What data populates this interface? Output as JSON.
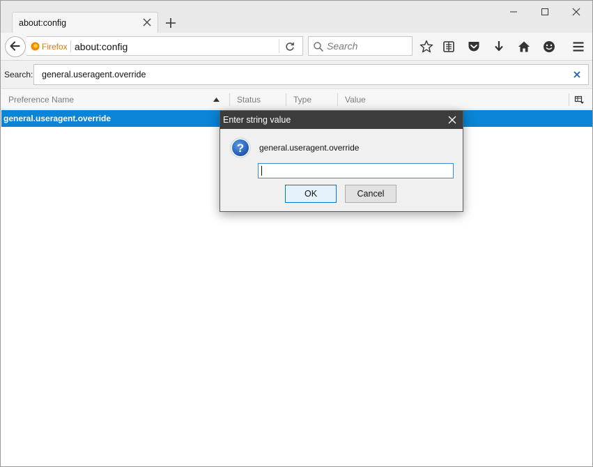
{
  "tab": {
    "title": "about:config"
  },
  "navbar": {
    "identity_label": "Firefox",
    "url": "about:config",
    "search_placeholder": "Search"
  },
  "config_search": {
    "label": "Search:",
    "value": "general.useragent.override"
  },
  "columns": {
    "name": "Preference Name",
    "status": "Status",
    "type": "Type",
    "value": "Value"
  },
  "rows": [
    {
      "name": "general.useragent.override"
    }
  ],
  "dialog": {
    "title": "Enter string value",
    "message": "general.useragent.override",
    "input_value": "",
    "ok_label": "OK",
    "cancel_label": "Cancel"
  },
  "colors": {
    "selection": "#0a84d6",
    "dialog_titlebar": "#3c3c3c",
    "identity": "#e37700"
  }
}
